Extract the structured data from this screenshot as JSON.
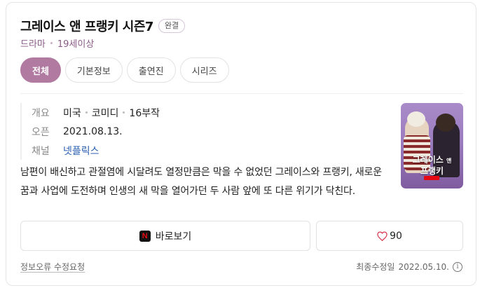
{
  "title": "그레이스 앤 프랭키 시즌7",
  "badge": "완결",
  "meta": {
    "genre": "드라마",
    "rating": "19세이상"
  },
  "tabs": [
    {
      "label": "전체",
      "active": true
    },
    {
      "label": "기본정보",
      "active": false
    },
    {
      "label": "출연진",
      "active": false
    },
    {
      "label": "시리즈",
      "active": false
    }
  ],
  "info": {
    "overview_label": "개요",
    "overview_values": [
      "미국",
      "코미디",
      "16부작"
    ],
    "open_label": "오픈",
    "open_value": "2021.08.13.",
    "channel_label": "채널",
    "channel_value": "넷플릭스"
  },
  "description": "남편이 배신하고 관절염에 시달려도 열정만큼은 막을 수 없었던 그레이스와 프랭키, 새로운 꿈과 사업에 도전하며 인생의 새 막을 열어가던 두 사람 앞에 또 다른 위기가 닥친다.",
  "poster": {
    "title_line1": "그레이스",
    "title_line2": "프랭키",
    "title_and": "앤",
    "icon": "netflix-poster"
  },
  "actions": {
    "watch_label": "바로보기",
    "watch_icon": "netflix-icon",
    "like_count": "90",
    "like_icon": "heart-icon"
  },
  "footer": {
    "report_label": "정보오류 수정요청",
    "updated_label": "최종수정일",
    "updated_date": "2022.05.10.",
    "info_icon": "info-icon"
  },
  "colors": {
    "accent": "#b07aa1",
    "link": "#2b5fb3",
    "netflix": "#e50914"
  }
}
